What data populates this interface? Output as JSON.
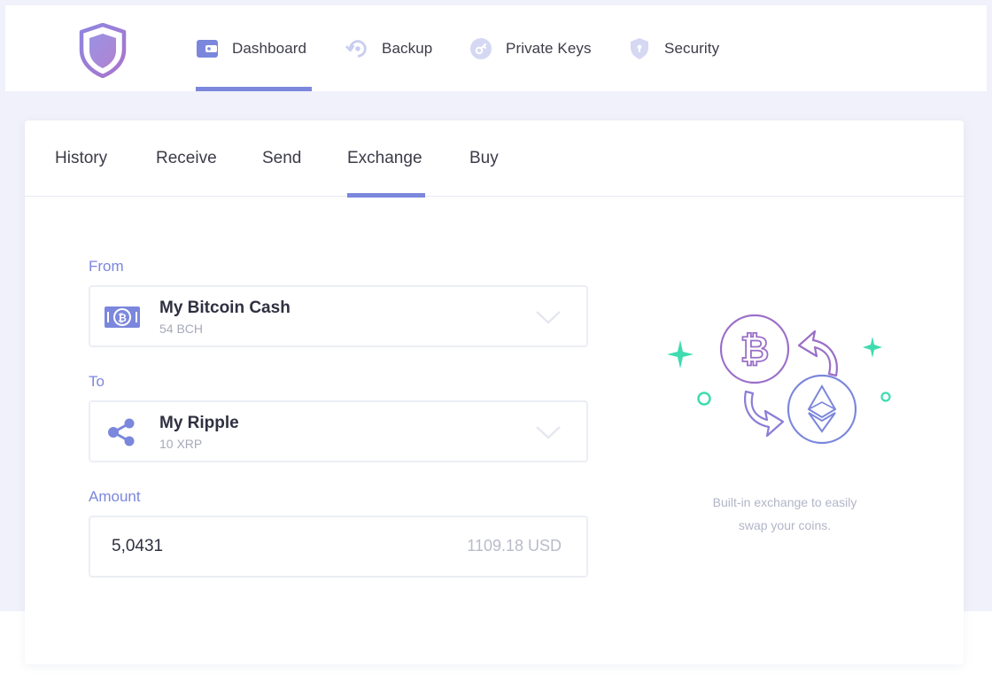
{
  "nav": {
    "items": [
      {
        "label": "Dashboard",
        "icon": "wallet-icon",
        "active": true
      },
      {
        "label": "Backup",
        "icon": "backup-icon",
        "active": false
      },
      {
        "label": "Private Keys",
        "icon": "key-icon",
        "active": false
      },
      {
        "label": "Security",
        "icon": "shield-lock-icon",
        "active": false
      }
    ]
  },
  "tabs": [
    {
      "label": "History",
      "active": false
    },
    {
      "label": "Receive",
      "active": false
    },
    {
      "label": "Send",
      "active": false
    },
    {
      "label": "Exchange",
      "active": true
    },
    {
      "label": "Buy",
      "active": false
    }
  ],
  "exchange": {
    "from": {
      "label": "From",
      "name": "My Bitcoin Cash",
      "balance": "54 BCH",
      "icon": "bitcoin-cash-icon"
    },
    "to": {
      "label": "To",
      "name": "My Ripple",
      "balance": "10 XRP",
      "icon": "ripple-icon"
    },
    "amount": {
      "label": "Amount",
      "value": "5,0431",
      "usd": "1109.18 USD"
    },
    "caption_line1": "Built-in exchange to easily",
    "caption_line2": "swap your coins."
  },
  "colors": {
    "accent": "#7b87dc",
    "purple": "#9b6fc8",
    "teal": "#3fdcb0",
    "background": "#f0f1fa"
  }
}
